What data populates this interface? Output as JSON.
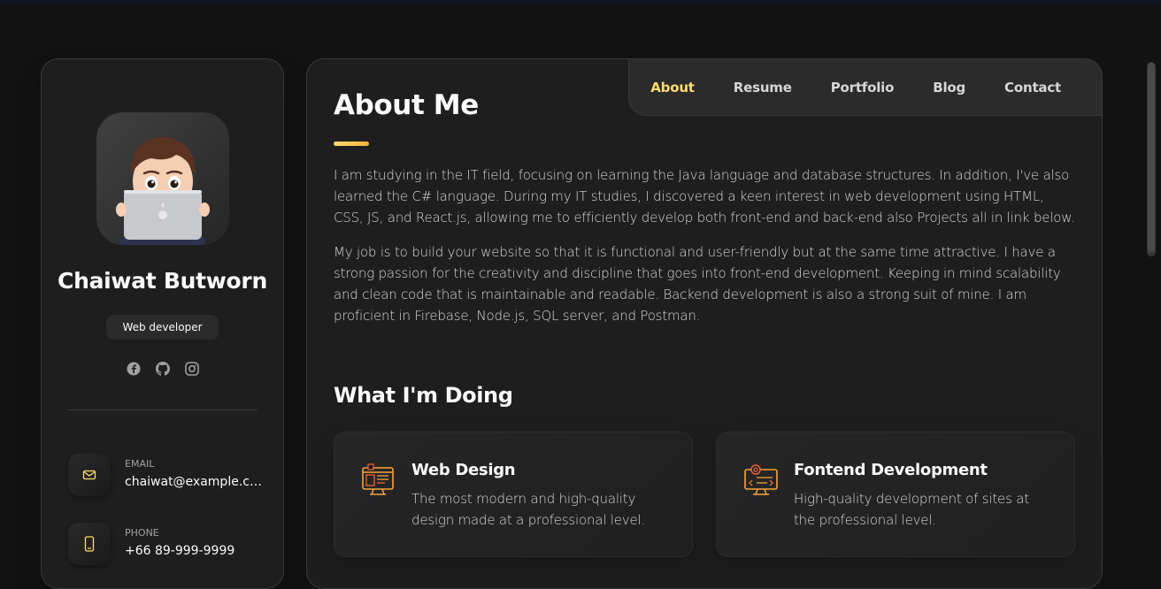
{
  "sidebar": {
    "name": "Chaiwat Butworn",
    "title": "Web developer",
    "socials": [
      "facebook-icon",
      "github-icon",
      "instagram-icon"
    ],
    "contacts": [
      {
        "label": "Email",
        "value": "chaiwat@example.com",
        "icon": "mail-icon"
      },
      {
        "label": "Phone",
        "value": "+66 89-999-9999",
        "icon": "phone-icon"
      }
    ]
  },
  "nav": {
    "items": [
      "About",
      "Resume",
      "Portfolio",
      "Blog",
      "Contact"
    ],
    "active": "About"
  },
  "about": {
    "title": "About Me",
    "paragraphs": [
      "I am studying in the IT field, focusing on learning the Java language and database structures. In addition, I've also learned the C# language. During my IT studies, I discovered a keen interest in web development using HTML, CSS, JS, and React.js, allowing me to efficiently develop both front-end and back-end also Projects all in link below.",
      "My job is to build your website so that it is functional and user-friendly but at the same time attractive. I have a strong passion for the creativity and discipline that goes into front-end development. Keeping in mind scalability and clean code that is maintainable and readable. Backend development is also a strong suit of mine. I am proficient in Firebase, Node.js, SQL server, and Postman."
    ]
  },
  "services": {
    "title": "What I'm Doing",
    "items": [
      {
        "title": "Web Design",
        "text": "The most modern and high-quality design made at a professional level.",
        "icon": "web-design-icon"
      },
      {
        "title": "Fontend Development",
        "text": "High-quality development of sites at the professional level.",
        "icon": "frontend-development-icon"
      }
    ]
  },
  "colors": {
    "accent": "#ffdb70",
    "background": "#121212",
    "card": "#1e1e1f"
  }
}
